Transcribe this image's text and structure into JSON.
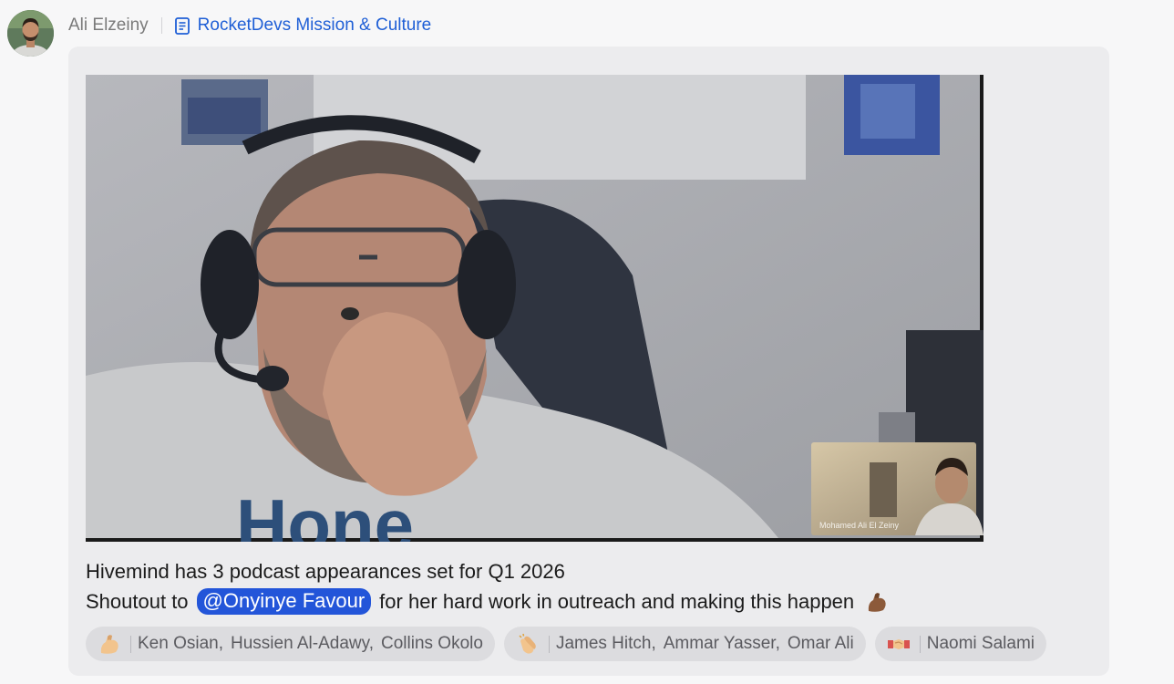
{
  "author": {
    "name": "Ali Elzeiny"
  },
  "channel": {
    "name": "RocketDevs Mission & Culture",
    "icon": "document-icon"
  },
  "video": {
    "overlay_name": "Mohamed Ali El Zeiny",
    "shirt_text": "Hone"
  },
  "message": {
    "line1": "Hivemind has 3 podcast appearances set for Q1 2026",
    "line2_before": "Shoutout to",
    "mention": "@Onyinye Favour",
    "line2_after": "for her hard work in outreach and making this happen",
    "emoji": "flexed-biceps-emoji"
  },
  "reactions": [
    {
      "emoji": "flexed-biceps-emoji",
      "users": [
        "Ken Osian,",
        "Hussien Al-Adawy,",
        "Collins Okolo"
      ]
    },
    {
      "emoji": "clapping-hands-emoji",
      "users": [
        "James Hitch,",
        "Ammar Yasser,",
        "Omar Ali"
      ]
    },
    {
      "emoji": "handshake-emoji",
      "users": [
        "Naomi Salami"
      ]
    }
  ],
  "colors": {
    "link": "#1f5fd6",
    "mention_bg": "#2355d9",
    "card_bg": "#ececee",
    "reaction_bg": "#dcdcdf"
  }
}
